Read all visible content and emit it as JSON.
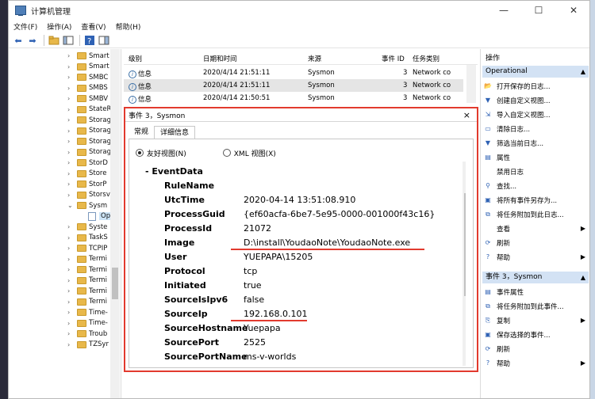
{
  "window": {
    "title": "计算机管理",
    "min": "—",
    "max": "☐",
    "close": "✕"
  },
  "menu": [
    "文件(F)",
    "操作(A)",
    "查看(V)",
    "帮助(H)"
  ],
  "tree": {
    "items": [
      "Smart",
      "Smart",
      "SMBC",
      "SMBS",
      "SMBV",
      "StateR",
      "Storag",
      "Storag",
      "Storag",
      "Storag",
      "StorD",
      "Store",
      "StorP",
      "Storsv",
      "Sysm",
      "Op",
      "Syste",
      "TaskS",
      "TCPIP",
      "Termi",
      "Termi",
      "Termi",
      "Termi",
      "Termi",
      "Time-",
      "Time-",
      "Troub",
      "TZSyr"
    ]
  },
  "event_list": {
    "columns": [
      "级别",
      "日期和时间",
      "来源",
      "事件 ID",
      "任务类别"
    ],
    "rows": [
      {
        "level": "信息",
        "datetime": "2020/4/14 21:51:11",
        "source": "Sysmon",
        "id": "3",
        "category": "Network co"
      },
      {
        "level": "信息",
        "datetime": "2020/4/14 21:51:11",
        "source": "Sysmon",
        "id": "3",
        "category": "Network co"
      },
      {
        "level": "信息",
        "datetime": "2020/4/14 21:50:51",
        "source": "Sysmon",
        "id": "3",
        "category": "Network co"
      }
    ]
  },
  "properties": {
    "title": "事件 3，Sysmon",
    "close": "×",
    "tabs": [
      "常规",
      "详细信息"
    ],
    "view_friendly": "友好视图(N)",
    "view_xml": "XML 视图(X)",
    "section": "-   EventData",
    "fields": [
      {
        "key": "RuleName",
        "value": ""
      },
      {
        "key": "UtcTime",
        "value": "2020-04-14 13:51:08.910"
      },
      {
        "key": "ProcessGuid",
        "value": "{ef60acfa-6be7-5e95-0000-001000f43c16}"
      },
      {
        "key": "ProcessId",
        "value": "21072"
      },
      {
        "key": "Image",
        "value": "D:\\install\\YoudaoNote\\YoudaoNote.exe"
      },
      {
        "key": "User",
        "value": "YUEPAPA\\15205"
      },
      {
        "key": "Protocol",
        "value": "tcp"
      },
      {
        "key": "Initiated",
        "value": "true"
      },
      {
        "key": "SourceIsIpv6",
        "value": "false"
      },
      {
        "key": "SourceIp",
        "value": "192.168.0.101"
      },
      {
        "key": "SourceHostname",
        "value": "Yuepapa"
      },
      {
        "key": "SourcePort",
        "value": "2525"
      },
      {
        "key": "SourcePortName",
        "value": "ms-v-worlds"
      }
    ]
  },
  "actions": {
    "title": "操作",
    "group1": "Operational",
    "group1_items": [
      {
        "icon": "open-log-icon",
        "label": "打开保存的日志..."
      },
      {
        "icon": "filter-icon",
        "label": "创建自定义视图..."
      },
      {
        "icon": "import-icon",
        "label": "导入自定义视图..."
      },
      {
        "icon": "clear-icon",
        "label": "清除日志..."
      },
      {
        "icon": "filter-icon",
        "label": "筛选当前日志..."
      },
      {
        "icon": "properties-icon",
        "label": "属性"
      },
      {
        "icon": "disable-icon",
        "label": "禁用日志"
      },
      {
        "icon": "find-icon",
        "label": "查找..."
      },
      {
        "icon": "save-icon",
        "label": "将所有事件另存为..."
      },
      {
        "icon": "task-icon",
        "label": "将任务附加到此日志..."
      },
      {
        "icon": "view-icon",
        "label": "查看"
      },
      {
        "icon": "refresh-icon",
        "label": "刷新"
      },
      {
        "icon": "help-icon",
        "label": "帮助"
      }
    ],
    "group2": "事件 3，Sysmon",
    "group2_items": [
      {
        "icon": "event-properties-icon",
        "label": "事件属性"
      },
      {
        "icon": "task-icon",
        "label": "将任务附加到此事件..."
      },
      {
        "icon": "copy-icon",
        "label": "复制"
      },
      {
        "icon": "save-icon",
        "label": "保存选择的事件..."
      },
      {
        "icon": "refresh-icon",
        "label": "刷新"
      },
      {
        "icon": "help-icon",
        "label": "帮助"
      }
    ]
  },
  "colors": {
    "highlight_red": "#e23a2e",
    "group_bg": "#d3e2f4",
    "selection_bg": "#cce4f7"
  }
}
